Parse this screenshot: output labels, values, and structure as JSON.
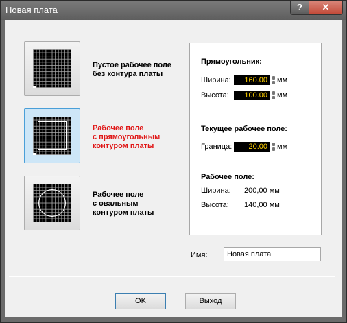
{
  "window": {
    "title": "Новая плата",
    "help_label": "?",
    "close_label": "✕"
  },
  "options": [
    {
      "label": "Пустое рабочее поле\nбез контура платы",
      "selected": false,
      "icon": "empty-grid-icon"
    },
    {
      "label": "Рабочее поле\nс прямоугольным\nконтуром платы",
      "selected": true,
      "icon": "rect-contour-grid-icon"
    },
    {
      "label": "Рабочее поле\nс овальным\nконтуром платы",
      "selected": false,
      "icon": "oval-contour-grid-icon"
    }
  ],
  "rect_section": {
    "title": "Прямоугольник:",
    "width_label": "Ширина:",
    "width_value": "160.00",
    "height_label": "Высота:",
    "height_value": "100.00",
    "unit": "мм"
  },
  "current_section": {
    "title": "Текущее рабочее поле:",
    "border_label": "Граница:",
    "border_value": "20.00",
    "unit": "мм"
  },
  "work_section": {
    "title": "Рабочее поле:",
    "width_label": "Ширина:",
    "width_value": "200,00 мм",
    "height_label": "Высота:",
    "height_value": "140,00 мм"
  },
  "name_field": {
    "label": "Имя:",
    "value": "Новая плата"
  },
  "buttons": {
    "ok_label": "OK",
    "exit_label": "Выход"
  },
  "colors": {
    "selected_text": "#e01818",
    "numeric_text": "#ffd000",
    "selected_option_bg": "#cde6f7"
  }
}
